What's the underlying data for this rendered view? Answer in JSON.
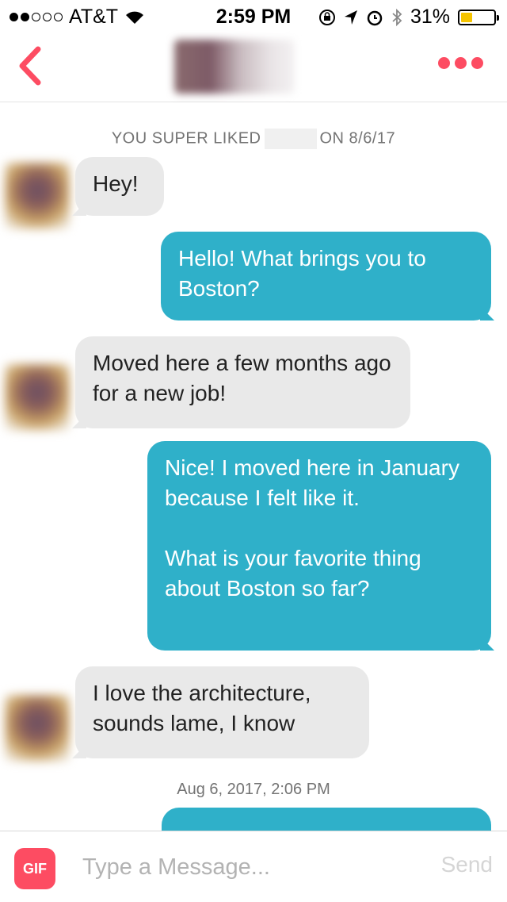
{
  "status_bar": {
    "carrier": "AT&T",
    "time": "2:59 PM",
    "battery": "31%",
    "battery_level": 0.31,
    "signal_dots_filled": 2,
    "signal_dots_total": 5,
    "icons": [
      "wifi-icon",
      "orientation-lock-icon",
      "location-icon",
      "alarm-icon",
      "bluetooth-icon",
      "battery-icon"
    ]
  },
  "nav": {
    "back_icon": "chevron-left-icon",
    "more_icon": "ellipsis-icon",
    "accent_color": "#fd4c62"
  },
  "chat": {
    "super_like_prefix": "YOU SUPER LIKED",
    "super_like_suffix": "ON 8/6/17",
    "messages": [
      {
        "from": "them",
        "text": "Hey!"
      },
      {
        "from": "me",
        "text": "Hello! What brings you to Boston?"
      },
      {
        "from": "them",
        "text": "Moved here a few months ago for a new job!"
      },
      {
        "from": "me",
        "text": "Nice! I moved here in January because I felt like it.\n\nWhat is your favorite thing about Boston so far?"
      },
      {
        "from": "them",
        "text": "I love the architecture, sounds lame, I know"
      }
    ],
    "timestamp": "Aug 6, 2017, 2:06 PM",
    "bubble_out_color": "#2fb0c9",
    "bubble_in_color": "#e9e9e9"
  },
  "composer": {
    "gif_label": "GIF",
    "placeholder": "Type a Message...",
    "send_label": "Send"
  }
}
